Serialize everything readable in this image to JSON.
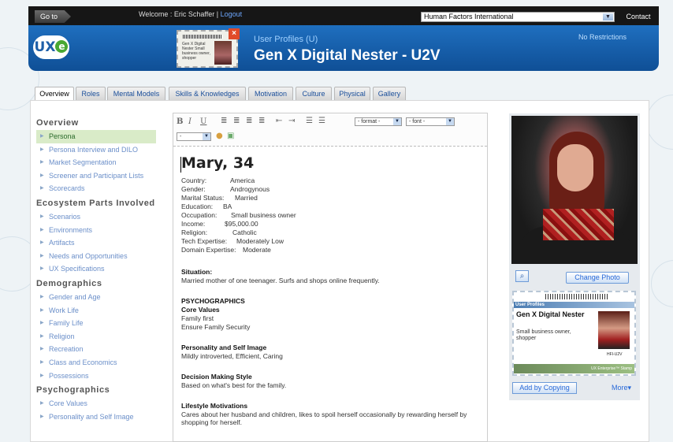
{
  "topbar": {
    "goto_label": "Go to",
    "welcome_prefix": "Welcome : Eric Schaffer |",
    "logout_label": "Logout",
    "org_selected": "Human Factors International",
    "contact_label": "Contact Us"
  },
  "header": {
    "logo_text": "UX",
    "logo_e": "e",
    "stamp_text": "Gen X Digital Nester Small business owner, shopper",
    "subtitle": "User Profiles (U)",
    "title": "Gen X Digital Nester - U2V",
    "restrictions": "No Restrictions"
  },
  "tabs": [
    {
      "label": "Overview"
    },
    {
      "label": "Roles"
    },
    {
      "label": "Mental Models"
    },
    {
      "label": "Skills & Knowledges"
    },
    {
      "label": "Motivation"
    },
    {
      "label": "Culture"
    },
    {
      "label": "Physical"
    },
    {
      "label": "Gallery"
    }
  ],
  "sidebar": {
    "overview_title": "Overview",
    "overview_items": [
      "Persona",
      "Persona Interview and DILO",
      "Market Segmentation",
      "Screener and Participant Lists",
      "Scorecards"
    ],
    "ecosystem_title": "Ecosystem Parts Involved",
    "ecosystem_items": [
      "Scenarios",
      "Environments",
      "Artifacts",
      "Needs and Opportunities",
      "UX Specifications"
    ],
    "demographics_title": "Demographics",
    "demographics_items": [
      "Gender and Age",
      "Work Life",
      "Family Life",
      "Religion",
      "Recreation",
      "Class and Economics",
      "Possessions"
    ],
    "psychographics_title": "Psychographics",
    "psychographics_items": [
      "Core Values",
      "Personality and Self Image"
    ]
  },
  "editor": {
    "toolbar": {
      "bold": "B",
      "italic": "I",
      "underline": "U",
      "format_select": "- format -",
      "font_select": "- font -",
      "size_select": "-"
    },
    "persona_name": "Mary, 34",
    "fields": [
      {
        "label": "Country:",
        "value": "America"
      },
      {
        "label": "Gender:",
        "value": "Androgynous"
      },
      {
        "label": "Marital Status:",
        "value": "Married"
      },
      {
        "label": "Education:",
        "value": "BA"
      },
      {
        "label": "Occupation:",
        "value": "Small business owner"
      },
      {
        "label": "Income:",
        "value": "$95,000.00"
      },
      {
        "label": "Religion:",
        "value": "Catholic"
      },
      {
        "label": "Tech Expertise:",
        "value": "Moderately Low"
      },
      {
        "label": "Domain Expertise:",
        "value": "Moderate"
      }
    ],
    "situation_title": "Situation:",
    "situation_text": "Married mother of one teenager. Surfs and shops online frequently.",
    "psychographics_title": "PSYCHOGRAPHICS",
    "core_values_title": "Core Values",
    "core_values_1": "Family first",
    "core_values_2": "Ensure Family Security",
    "personality_title": "Personality and Self Image",
    "personality_text": "Mildly introverted, Efficient, Caring",
    "decision_title": "Decision Making Style",
    "decision_text": "Based on what's best for the family.",
    "lifestyle_title": "Lifestyle Motivations",
    "lifestyle_text": "Cares about her husband and children, likes to spoil herself occasionally by rewarding herself by shopping for herself."
  },
  "right_panel": {
    "change_photo_label": "Change Photo",
    "card_header": "User Profiles",
    "card_name": "Gen X Digital Nester",
    "card_desc": "Small business owner, shopper",
    "card_code": "HFI-U2V",
    "card_footer": "UX Enterprise™ Stamp",
    "add_by_copying_label": "Add by Copying",
    "more_label": "More▾"
  }
}
